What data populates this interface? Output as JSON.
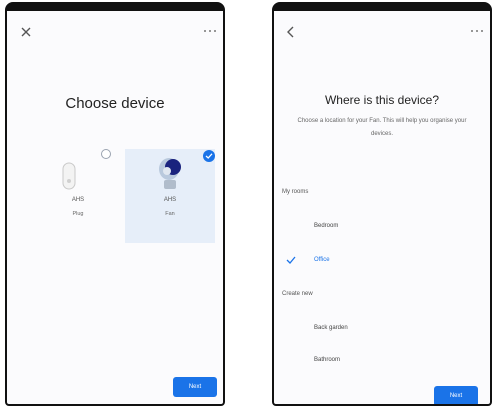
{
  "left_screen": {
    "title": "Choose device",
    "devices": [
      {
        "name": "AHS",
        "type": "Plug",
        "selected": false
      },
      {
        "name": "AHS",
        "type": "Fan",
        "selected": true
      }
    ],
    "next_label": "Next"
  },
  "right_screen": {
    "title": "Where is this device?",
    "subtitle": "Choose a location for your Fan. This will help you organise your devices.",
    "my_rooms_header": "My rooms",
    "my_rooms": [
      {
        "label": "Bedroom",
        "selected": false
      },
      {
        "label": "Office",
        "selected": true
      }
    ],
    "create_new_header": "Create new",
    "create_new": [
      {
        "label": "Back garden"
      },
      {
        "label": "Bathroom"
      }
    ],
    "next_label": "Next"
  },
  "colors": {
    "accent": "#1a73e8",
    "selected_card": "#e6eef9"
  }
}
